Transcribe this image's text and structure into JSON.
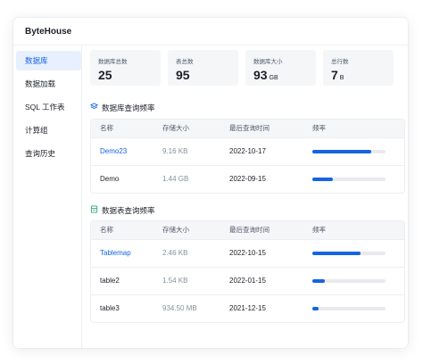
{
  "app": {
    "title": "ByteHouse"
  },
  "sidebar": {
    "items": [
      {
        "label": "数据库",
        "active": true
      },
      {
        "label": "数据加载",
        "active": false
      },
      {
        "label": "SQL 工作表",
        "active": false
      },
      {
        "label": "计算组",
        "active": false
      },
      {
        "label": "查询历史",
        "active": false
      }
    ]
  },
  "stats": [
    {
      "label": "数据库总数",
      "value": "25",
      "unit": ""
    },
    {
      "label": "表总数",
      "value": "95",
      "unit": ""
    },
    {
      "label": "数据库大小",
      "value": "93",
      "unit": "GB"
    },
    {
      "label": "总行数",
      "value": "7",
      "unit": "B"
    }
  ],
  "db_section": {
    "title": "数据库查询频率",
    "icon": "layers-icon",
    "columns": [
      "名称",
      "存储大小",
      "最后查询时间",
      "频率"
    ],
    "rows": [
      {
        "name": "Demo23",
        "size": "9.16 KB",
        "date": "2022-10-17",
        "freq": 0.8,
        "link": true
      },
      {
        "name": "Demo",
        "size": "1.44 GB",
        "date": "2022-09-15",
        "freq": 0.28,
        "link": false
      }
    ]
  },
  "table_section": {
    "title": "数据表查询频率",
    "icon": "table-icon",
    "columns": [
      "名称",
      "存储大小",
      "最后查询时间",
      "频率"
    ],
    "rows": [
      {
        "name": "Tablemap",
        "size": "2.46 KB",
        "date": "2022-10-15",
        "freq": 0.66,
        "link": true
      },
      {
        "name": "table2",
        "size": "1.54 KB",
        "date": "2022-01-15",
        "freq": 0.17,
        "link": false
      },
      {
        "name": "table3",
        "size": "934.50 MB",
        "date": "2021-12-15",
        "freq": 0.08,
        "link": false
      }
    ]
  },
  "colors": {
    "accent": "#1664e0",
    "active_bg": "#e8f0fe",
    "card_bg": "#f5f6f8"
  }
}
